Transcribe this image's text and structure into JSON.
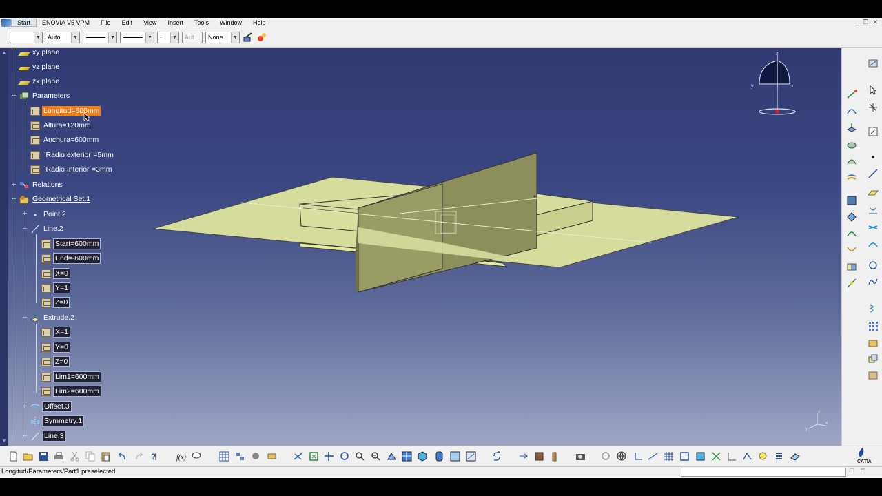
{
  "menu": {
    "items": [
      "Start",
      "ENOVIA V5 VPM",
      "File",
      "Edit",
      "View",
      "Insert",
      "Tools",
      "Window",
      "Help"
    ],
    "active": "Start"
  },
  "toolbar_top": {
    "color_combo": "",
    "transparency_combo": "Auto",
    "linetype_combo": "",
    "thickness_combo": "",
    "point_combo": "·",
    "layer_combo_disabled": "Aut",
    "layer_combo": "None"
  },
  "tree": {
    "xy_plane": "xy plane",
    "yz_plane": "yz plane",
    "zx_plane": "zx plane",
    "parameters": "Parameters",
    "longitud": "Longitud=600mm",
    "altura": "Altura=120mm",
    "anchura": "Anchura=600mm",
    "radio_exterior": "`Radio exterior`=5mm",
    "radio_interior": "`Radio Interior`=3mm",
    "relations": "Relations",
    "geometrical_set": "Geometrical Set.1",
    "point2": "Point.2",
    "line2": "Line.2",
    "start": "Start=600mm",
    "end": "End=-600mm",
    "line_x": "X=0",
    "line_y": "Y=1",
    "line_z": "Z=0",
    "extrude2": "Extrude.2",
    "ext_x": "X=1",
    "ext_y": "Y=0",
    "ext_z": "Z=0",
    "lim1": "Lim1=600mm",
    "lim2": "Lim2=600mm",
    "offset3": "Offset.3",
    "symmetry1": "Symmetry.1",
    "line3": "Line.3"
  },
  "compass": {
    "x_label": "x",
    "y_label": "y",
    "z_label": "z"
  },
  "axis_triad": {
    "x_label": "x",
    "y_label": "y",
    "z_label": "z"
  },
  "status": {
    "text": "Longitud/Parameters/Part1 preselected",
    "input_value": ""
  },
  "colors": {
    "highlight": "#f07d18",
    "viewport_top": "#313a72",
    "viewport_bottom": "#9ea6c5",
    "surface_fill": "#d6dd9c",
    "surface_dark": "#7a7d4e"
  },
  "brand": {
    "logo_text": "CATIA"
  }
}
